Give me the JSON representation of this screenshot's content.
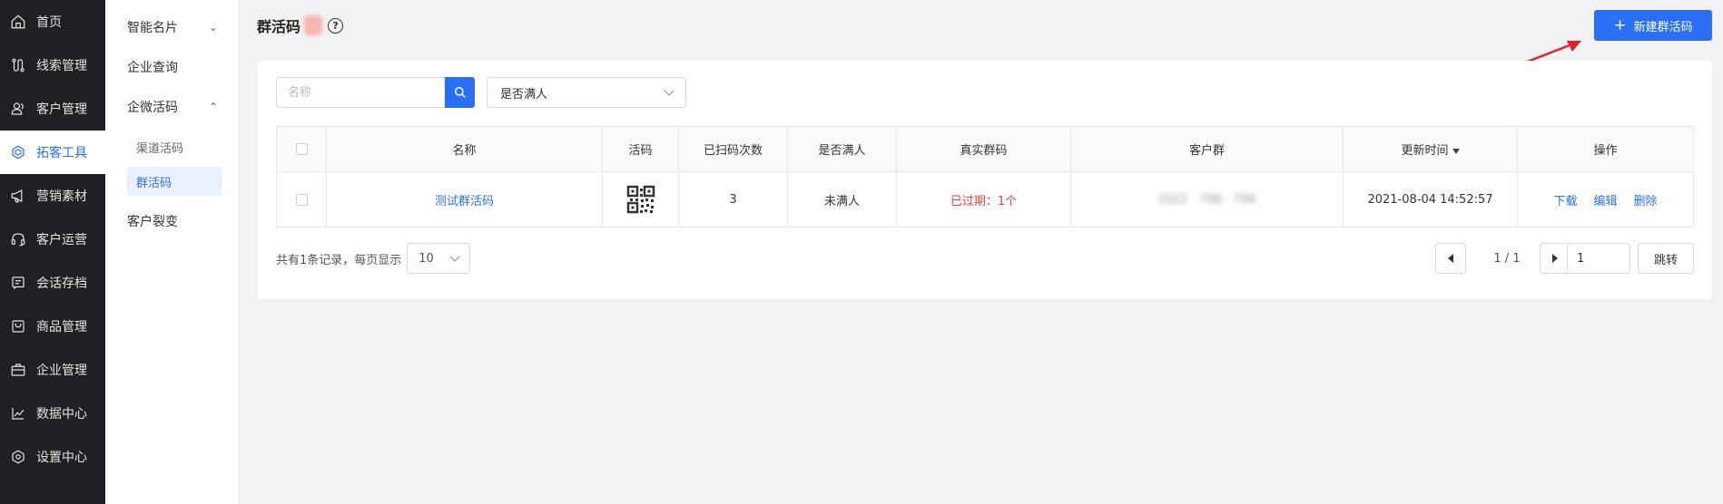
{
  "sidebar": {
    "items": [
      {
        "label": "首页",
        "icon": "home-icon"
      },
      {
        "label": "线索管理",
        "icon": "route-icon"
      },
      {
        "label": "客户管理",
        "icon": "users-icon"
      },
      {
        "label": "拓客工具",
        "icon": "tool-icon",
        "active": true
      },
      {
        "label": "营销素材",
        "icon": "megaphone-icon"
      },
      {
        "label": "客户运营",
        "icon": "headset-icon"
      },
      {
        "label": "会话存档",
        "icon": "message-icon"
      },
      {
        "label": "商品管理",
        "icon": "bag-icon"
      },
      {
        "label": "企业管理",
        "icon": "briefcase-icon"
      },
      {
        "label": "数据中心",
        "icon": "chart-icon"
      },
      {
        "label": "设置中心",
        "icon": "settings-icon"
      }
    ]
  },
  "submenu": {
    "smart_card": "智能名片",
    "enterprise_query": "企业查询",
    "wecom_qrcode": "企微活码",
    "channel_qrcode": "渠道活码",
    "group_qrcode": "群活码",
    "customer_fission": "客户裂变"
  },
  "header": {
    "title": "群活码",
    "help": "?",
    "create_label": "新建群活码"
  },
  "filters": {
    "name_placeholder": "名称",
    "full_select_value": "是否满人"
  },
  "table": {
    "columns": [
      "名称",
      "活码",
      "已扫码次数",
      "是否满人",
      "真实群码",
      "客户群",
      "更新时间",
      "操作"
    ],
    "rows": [
      {
        "name": "测试群活码",
        "scan_count": "3",
        "is_full": "未满人",
        "real_code": "已过期：1个",
        "customer_group": "2021 · 798 · 798",
        "updated_at": "2021-08-04 14:52:57",
        "ops": {
          "download": "下载",
          "edit": "编辑",
          "delete": "删除"
        }
      }
    ]
  },
  "footer": {
    "total_text": "共有1条记录，每页显示",
    "page_size": "10",
    "page_info": "1 / 1",
    "jump_value": "1",
    "jump_label": "跳转"
  },
  "colors": {
    "primary": "#2b6ff5",
    "danger": "#f03e3e",
    "sidebar_bg": "#1f2024",
    "annotation_arrow": "#e0242c"
  }
}
